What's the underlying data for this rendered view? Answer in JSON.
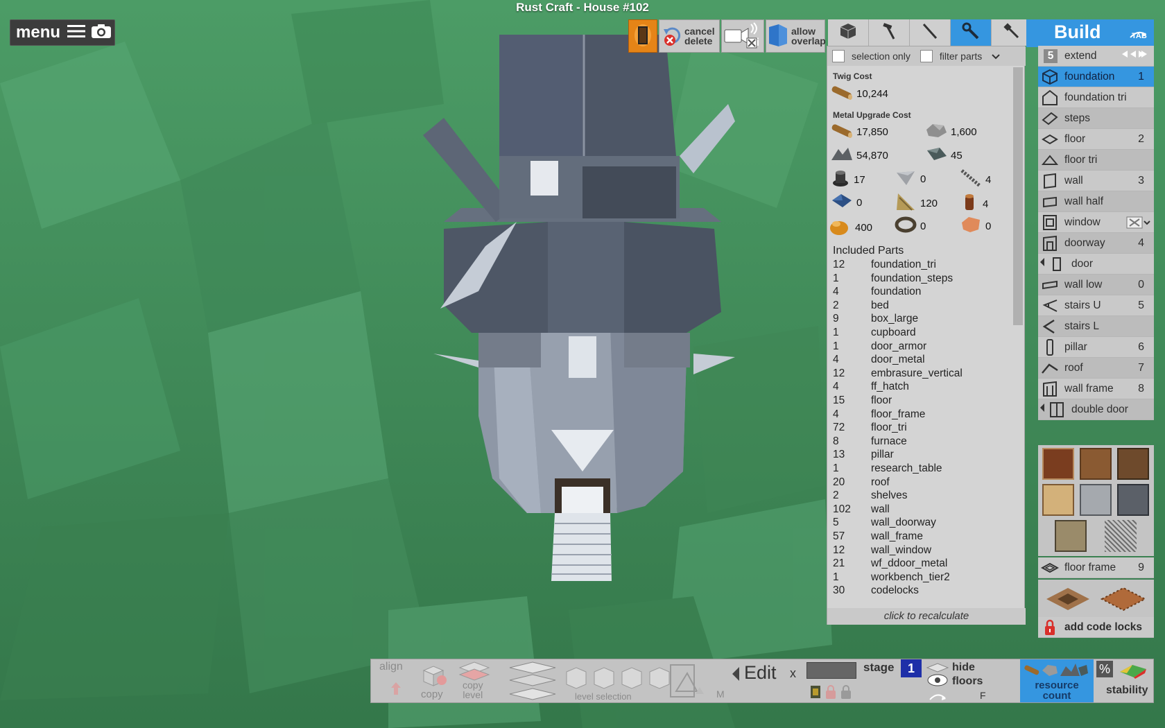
{
  "window": {
    "title": "Rust Craft - House #102"
  },
  "menu": {
    "label": "menu"
  },
  "top_toolbar": {
    "cancel_delete": [
      "cancel",
      "delete"
    ],
    "allow_overlap": [
      "allow",
      "overlap"
    ],
    "camera_extra": "i"
  },
  "filters": {
    "selection_only": "selection only",
    "filter_parts": "filter parts"
  },
  "costs": {
    "twig_title": "Twig Cost",
    "twig_wood": "10,244",
    "metal_title": "Metal Upgrade Cost",
    "items": [
      {
        "icon": "wood-icon",
        "value": "17,850"
      },
      {
        "icon": "stone-icon",
        "value": "1,600"
      },
      {
        "icon": "metal-fragments-icon",
        "value": "54,870"
      },
      {
        "icon": "high-quality-metal-icon",
        "value": "45"
      },
      {
        "icon": "gears-icon",
        "value": "17"
      },
      {
        "icon": "sheet-metal-icon",
        "value": "0"
      },
      {
        "icon": "pipe-icon",
        "value": "4"
      },
      {
        "icon": "tarp-icon",
        "value": "0"
      },
      {
        "icon": "cloth-icon",
        "value": "120"
      },
      {
        "icon": "lantern-icon",
        "value": "4"
      },
      {
        "icon": "lowgrade-fuel-icon",
        "value": "400"
      },
      {
        "icon": "rope-icon",
        "value": "0"
      },
      {
        "icon": "leather-icon",
        "value": "0"
      }
    ]
  },
  "included_parts": {
    "title": "Included Parts",
    "rows": [
      {
        "qty": "12",
        "name": "foundation_tri"
      },
      {
        "qty": "1",
        "name": "foundation_steps"
      },
      {
        "qty": "4",
        "name": "foundation"
      },
      {
        "qty": "2",
        "name": "bed"
      },
      {
        "qty": "9",
        "name": "box_large"
      },
      {
        "qty": "1",
        "name": "cupboard"
      },
      {
        "qty": "1",
        "name": "door_armor"
      },
      {
        "qty": "4",
        "name": "door_metal"
      },
      {
        "qty": "12",
        "name": "embrasure_vertical"
      },
      {
        "qty": "4",
        "name": "ff_hatch"
      },
      {
        "qty": "15",
        "name": "floor"
      },
      {
        "qty": "4",
        "name": "floor_frame"
      },
      {
        "qty": "72",
        "name": "floor_tri"
      },
      {
        "qty": "8",
        "name": "furnace"
      },
      {
        "qty": "13",
        "name": "pillar"
      },
      {
        "qty": "1",
        "name": "research_table"
      },
      {
        "qty": "20",
        "name": "roof"
      },
      {
        "qty": "2",
        "name": "shelves"
      },
      {
        "qty": "102",
        "name": "wall"
      },
      {
        "qty": "5",
        "name": "wall_doorway"
      },
      {
        "qty": "57",
        "name": "wall_frame"
      },
      {
        "qty": "12",
        "name": "wall_window"
      },
      {
        "qty": "21",
        "name": "wf_ddoor_metal"
      },
      {
        "qty": "1",
        "name": "workbench_tier2"
      },
      {
        "qty": "30",
        "name": "codelocks"
      }
    ],
    "recalculate": "click to recalculate"
  },
  "build": {
    "title": "Build",
    "tab_hint": "TAB",
    "extend_count": "5",
    "extend_label": "extend",
    "items": [
      {
        "name": "foundation",
        "num": "1",
        "icon": "cube-icon"
      },
      {
        "name": "foundation tri",
        "num": "",
        "icon": "triangle-block-icon"
      },
      {
        "name": "steps",
        "num": "",
        "icon": "steps-icon"
      },
      {
        "name": "floor",
        "num": "2",
        "icon": "floor-icon"
      },
      {
        "name": "floor tri",
        "num": "",
        "icon": "floor-tri-icon"
      },
      {
        "name": "wall",
        "num": "3",
        "icon": "wall-icon"
      },
      {
        "name": "wall half",
        "num": "",
        "icon": "wall-half-icon"
      },
      {
        "name": "window",
        "num": "",
        "icon": "window-icon"
      },
      {
        "name": "doorway",
        "num": "4",
        "icon": "doorway-icon"
      },
      {
        "name": "door",
        "num": "",
        "icon": "door-icon"
      },
      {
        "name": "wall low",
        "num": "0",
        "icon": "wall-low-icon"
      },
      {
        "name": "stairs U",
        "num": "5",
        "icon": "stairs-u-icon"
      },
      {
        "name": "stairs L",
        "num": "",
        "icon": "stairs-l-icon"
      },
      {
        "name": "pillar",
        "num": "6",
        "icon": "pillar-icon"
      },
      {
        "name": "roof",
        "num": "7",
        "icon": "roof-icon"
      },
      {
        "name": "wall frame",
        "num": "8",
        "icon": "wall-frame-icon"
      },
      {
        "name": "double door",
        "num": "",
        "icon": "double-door-icon"
      }
    ],
    "floor_frame": {
      "name": "floor frame",
      "num": "9"
    },
    "add_code_locks": "add code locks"
  },
  "bottom_bar": {
    "align": "align",
    "copy": "copy",
    "copy_level": [
      "copy",
      "level"
    ],
    "level_selection": "level selection",
    "m_key": "M",
    "edit": "Edit",
    "close": "x",
    "stage_label": "stage",
    "stage_value": "1",
    "hide_floors": [
      "hide",
      "floors"
    ],
    "f_key": "F",
    "resource_count": [
      "resource",
      "count"
    ],
    "percent": "%",
    "stability": "stability"
  },
  "colors": {
    "accent": "#3596e0",
    "panel": "#d4d4d4",
    "terrain": "#3f8a5a",
    "danger": "#d9302b"
  }
}
